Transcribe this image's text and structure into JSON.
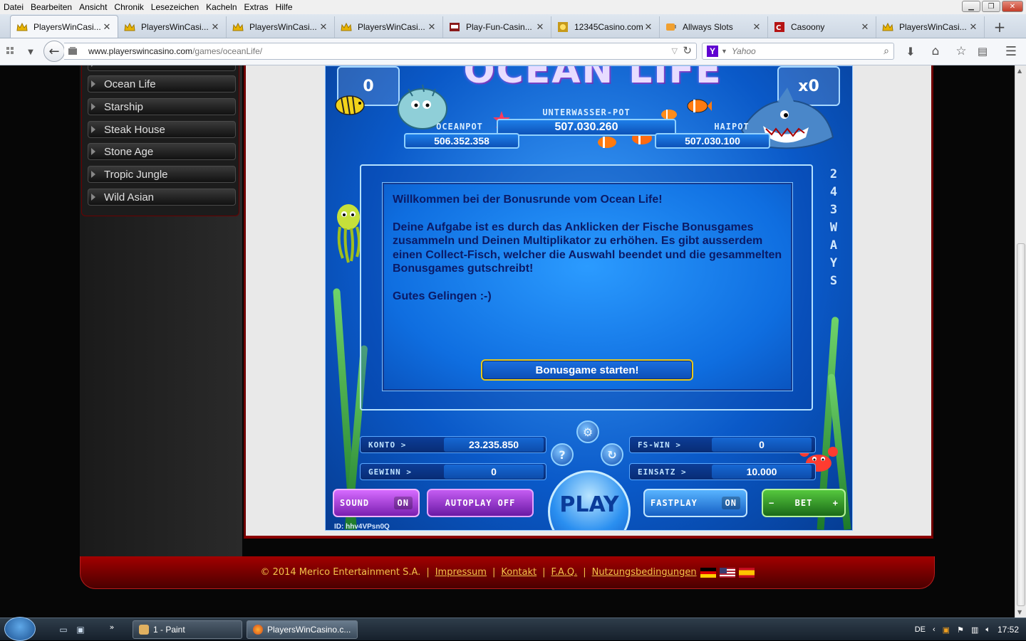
{
  "menubar": {
    "items": [
      "Datei",
      "Bearbeiten",
      "Ansicht",
      "Chronik",
      "Lesezeichen",
      "Kacheln",
      "Extras",
      "Hilfe"
    ]
  },
  "tabs": [
    {
      "title": "PlayersWinCasi...",
      "icon": "crown-icon",
      "active": true
    },
    {
      "title": "PlayersWinCasi...",
      "icon": "crown-icon"
    },
    {
      "title": "PlayersWinCasi...",
      "icon": "crown-icon"
    },
    {
      "title": "PlayersWinCasi...",
      "icon": "crown-icon"
    },
    {
      "title": "Play-Fun-Casin...",
      "icon": "slot-icon"
    },
    {
      "title": "12345Casino.com",
      "icon": "coin-icon"
    },
    {
      "title": "Allways Slots",
      "icon": "slot-machine-icon"
    },
    {
      "title": "Casoony",
      "icon": "casoony-logo-icon"
    },
    {
      "title": "PlayersWinCasi...",
      "icon": "crown-icon"
    }
  ],
  "navbar": {
    "url_domain": "www.playerswincasino.com",
    "url_path": "/games/oceanLife/",
    "search_placeholder": "Yahoo"
  },
  "sidebar": {
    "items": [
      "Ocean Life",
      "Starship",
      "Steak House",
      "Stone Age",
      "Tropic Jungle",
      "Wild Asian"
    ]
  },
  "game": {
    "title": "OCEAN LIFE",
    "left_corner": "0",
    "right_corner": "x0",
    "oceanpot_label": "OCEANPOT",
    "oceanpot_value": "506.352.358",
    "unterwasser_label": "UNTERWASSER-POT",
    "unterwasser_value": "507.030.260",
    "haipot_label": "HAIPOT",
    "haipot_value": "507.030.100",
    "ways": [
      "2",
      "4",
      "3",
      "W",
      "A",
      "Y",
      "S"
    ],
    "bonus": {
      "heading": "Willkommen bei der Bonusrunde vom Ocean Life!",
      "body": "Deine Aufgabe ist es durch das Anklicken der Fische Bonusgames zusammeln und Deinen Multiplikator zu erhöhen. Es gibt ausserdem einen Collect-Fisch, welcher die Auswahl beendet und die gesammelten Bonusgames gutschreibt!",
      "closing": "Gutes Gelingen :-)",
      "button": "Bonusgame starten!"
    },
    "stats": {
      "konto_label": "KONTO >",
      "konto_value": "23.235.850",
      "gewinn_label": "GEWINN >",
      "gewinn_value": "0",
      "fswin_label": "FS-WIN >",
      "fswin_value": "0",
      "einsatz_label": "EINSATZ >",
      "einsatz_value": "10.000"
    },
    "controls": {
      "sound_label": "SOUND",
      "sound_state": "ON",
      "autoplay_label": "AUTOPLAY OFF",
      "play_label": "PLAY",
      "fastplay_label": "FASTPLAY",
      "fastplay_state": "ON",
      "bet_minus": "−",
      "bet_label": "BET",
      "bet_plus": "+",
      "help_icon_text": "?",
      "refresh_icon_text": "↻"
    },
    "id_text": "ID: hhv4VPsn0Q"
  },
  "footer": {
    "copyright": "© 2014 Merico Entertainment S.A.",
    "links": [
      "Impressum",
      "Kontakt",
      "F.A.Q.",
      "Nutzungsbedingungen"
    ]
  },
  "taskbar": {
    "paint_label": "1 - Paint",
    "firefox_label": "PlayersWinCasino.c...",
    "lang": "DE",
    "time": "17:52"
  },
  "colors": {
    "footer_text": "#f2c44b",
    "game_blue": "#0a59c8",
    "frame_red": "#8a0000"
  }
}
